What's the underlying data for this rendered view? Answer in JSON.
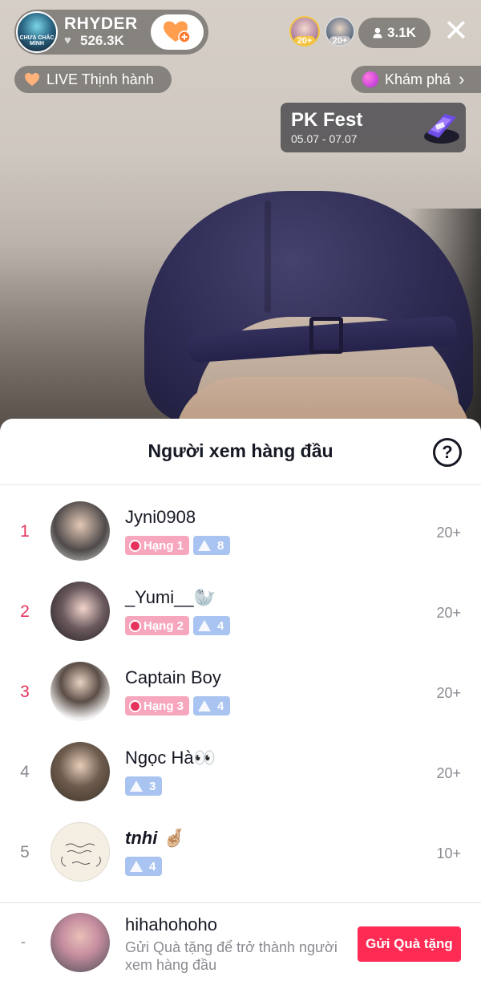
{
  "host": {
    "name": "RHYDER",
    "likes": "526.3K",
    "avatar_text": "CHƯA CHẮC MÌNH"
  },
  "top_viewers": [
    {
      "badge": "20+"
    },
    {
      "badge": "20+"
    }
  ],
  "viewer_count": "3.1K",
  "live_tag": "LIVE Thịnh hành",
  "explore_label": "Khám phá",
  "event": {
    "title": "PK Fest",
    "dates": "05.07 - 07.07"
  },
  "sheet": {
    "title": "Người xem hàng đầu",
    "rows": [
      {
        "rank": "1",
        "name": "Jyni0908",
        "rank_badge": "Hạng 1",
        "level": "8",
        "score": "20+"
      },
      {
        "rank": "2",
        "name": "_Yumi__🦭",
        "rank_badge": "Hạng 2",
        "level": "4",
        "score": "20+"
      },
      {
        "rank": "3",
        "name": "Captain Boy",
        "rank_badge": "Hạng 3",
        "level": "4",
        "score": "20+"
      },
      {
        "rank": "4",
        "name": "Ngọc Hà👀",
        "level": "3",
        "score": "20+"
      },
      {
        "rank": "5",
        "name": "tnhi 🤞🏼",
        "level": "4",
        "score": "10+"
      }
    ],
    "self": {
      "rank": "-",
      "name": "hihahohoho",
      "hint": "Gửi Quà tặng để trở thành người xem hàng đầu",
      "button": "Gửi Quà tặng"
    }
  },
  "colors": {
    "accent": "#fe2c55",
    "rank_top": "#e6325c",
    "rank_badge": "#f7a7bd",
    "level_badge": "#a9c4f1"
  }
}
